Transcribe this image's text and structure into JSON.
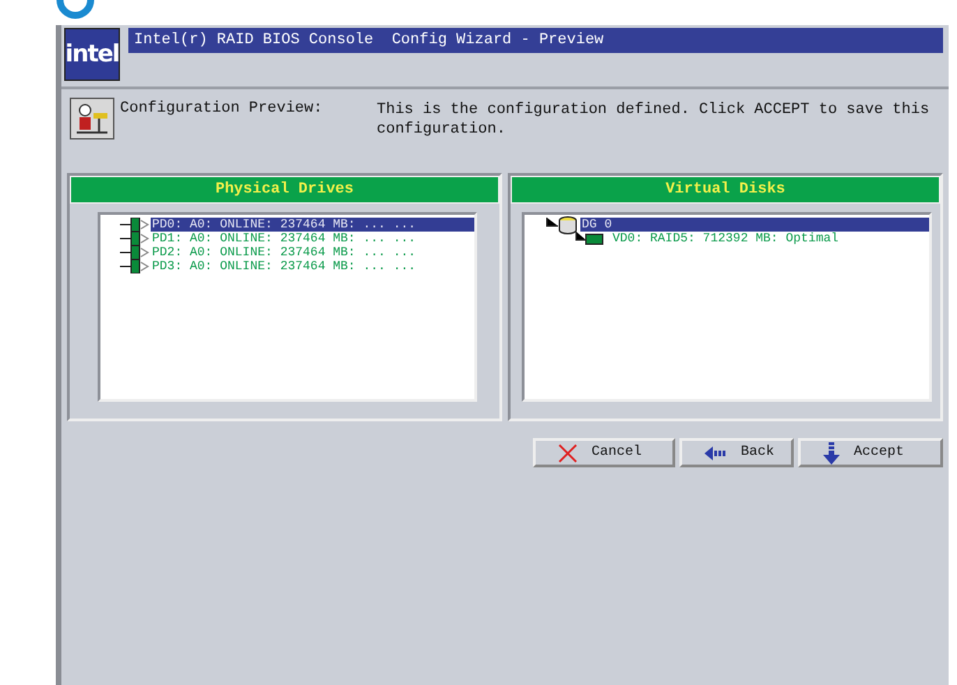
{
  "window": {
    "logo": "intel",
    "title": "Intel(r) RAID BIOS Console  Config Wizard - Preview"
  },
  "info": {
    "label": "Configuration Preview:",
    "message": "This is the configuration defined. Click ACCEPT to save this configuration."
  },
  "panels": [
    {
      "title": "Physical Drives",
      "items": [
        {
          "kind": "drive",
          "label": "PD0: A0: ONLINE: 237464 MB: ... ...",
          "selected": true
        },
        {
          "kind": "drive",
          "label": "PD1: A0: ONLINE: 237464 MB: ... ...",
          "selected": false
        },
        {
          "kind": "drive",
          "label": "PD2: A0: ONLINE: 237464 MB: ... ...",
          "selected": false
        },
        {
          "kind": "drive",
          "label": "PD3: A0: ONLINE: 237464 MB: ... ...",
          "selected": false
        }
      ]
    },
    {
      "title": "Virtual Disks",
      "items": [
        {
          "kind": "group",
          "label": "DG 0",
          "selected": true,
          "children": [
            {
              "kind": "virtual",
              "label": "VD0: RAID5: 712392 MB: Optimal",
              "selected": false
            }
          ]
        }
      ]
    }
  ],
  "buttons": [
    {
      "kind": "cancel",
      "label": "Cancel"
    },
    {
      "kind": "back",
      "label": "Back"
    },
    {
      "kind": "accept",
      "label": "Accept"
    }
  ]
}
